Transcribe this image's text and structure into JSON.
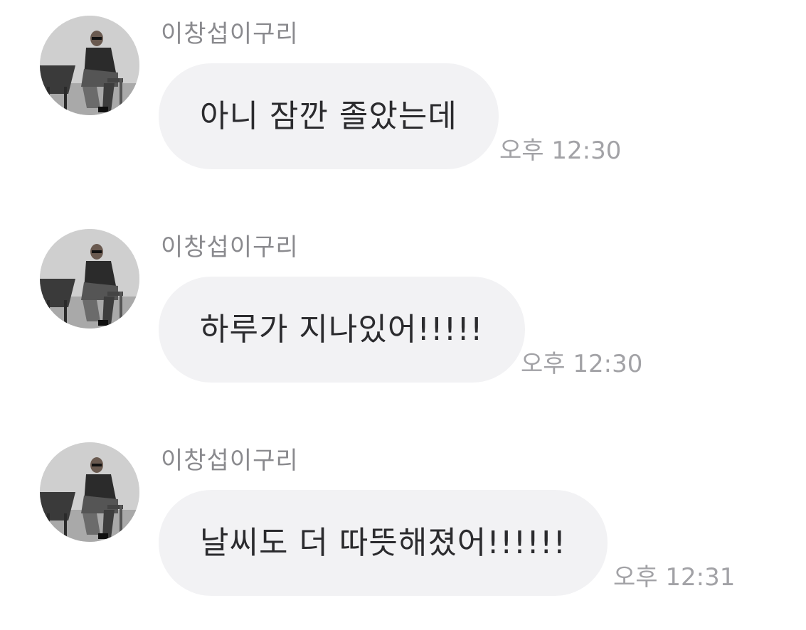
{
  "messages": [
    {
      "sender": "이창섭이구리",
      "text": "아니 잠깐 졸았는데",
      "time": "오후 12:30",
      "avatar_icon": "profile-photo"
    },
    {
      "sender": "이창섭이구리",
      "text": "하루가 지나있어!!!!!",
      "time": "오후 12:30",
      "avatar_icon": "profile-photo"
    },
    {
      "sender": "이창섭이구리",
      "text": "날씨도 더 따뜻해졌어!!!!!!",
      "time": "오후 12:31",
      "avatar_icon": "profile-photo"
    }
  ],
  "colors": {
    "background": "#ffffff",
    "bubble": "#f2f2f4",
    "sender_text": "#8a8a8e",
    "message_text": "#2b2b2e",
    "time_text": "#a2a2a6"
  }
}
